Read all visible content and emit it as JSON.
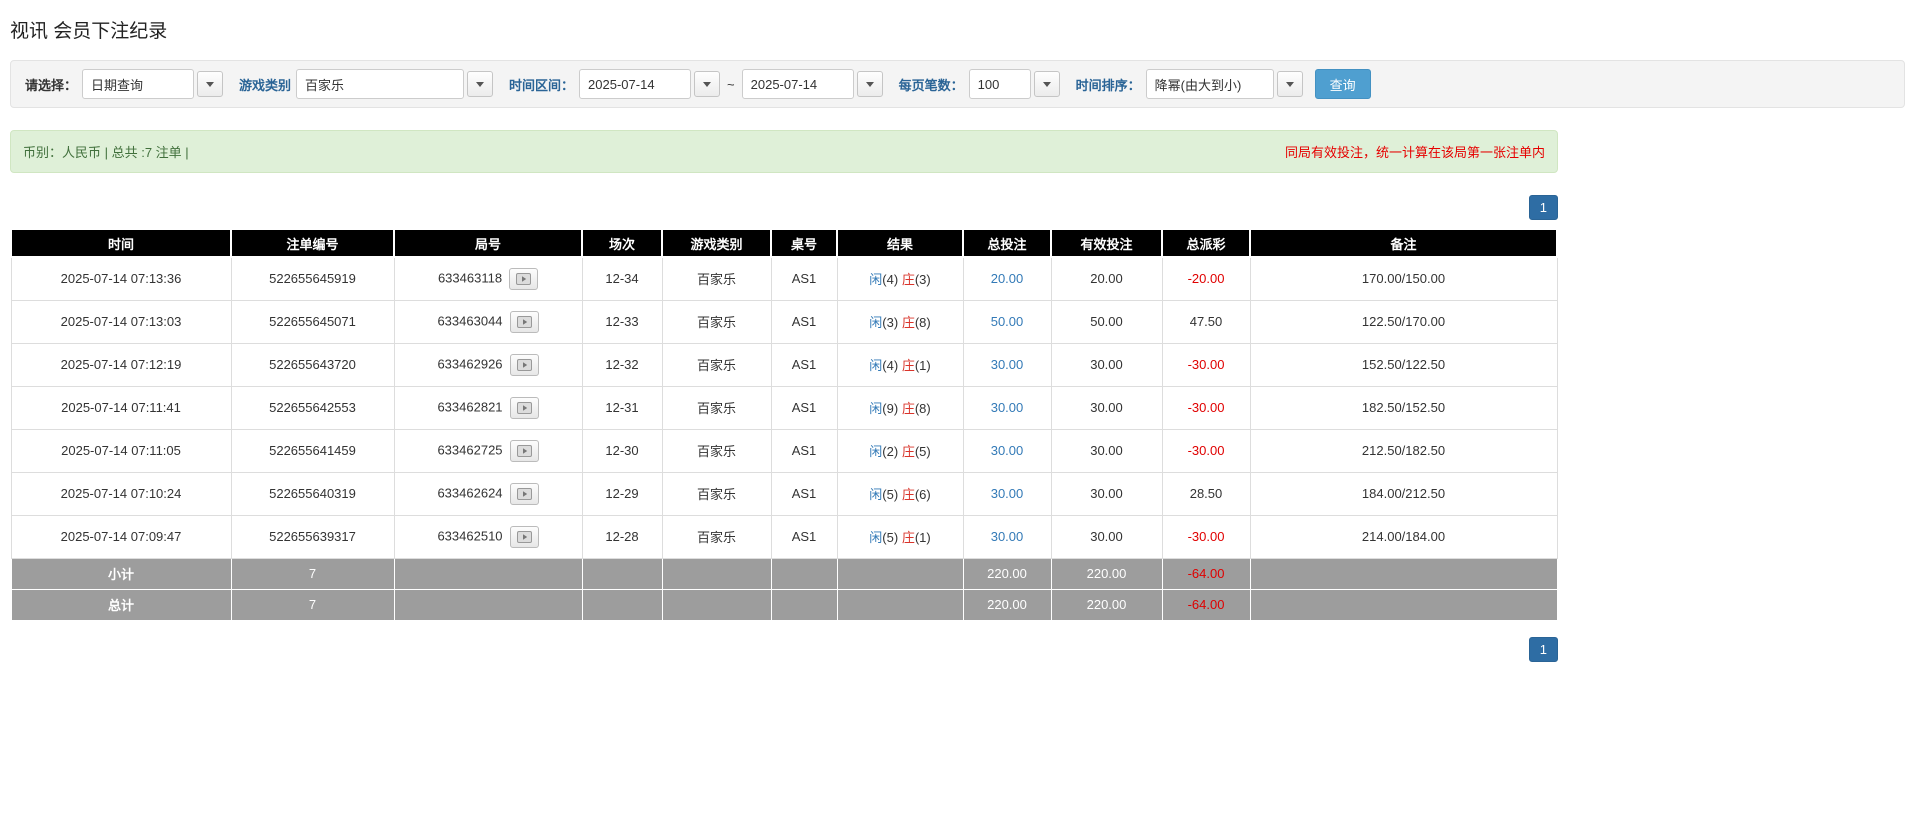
{
  "page": {
    "title": "视讯 会员下注纪录"
  },
  "filters": {
    "select_label": "请选择：",
    "select_value": "日期查询",
    "game_type_label": "游戏类别",
    "game_type_value": "百家乐",
    "date_range_label": "时间区间：",
    "date_from": "2025-07-14",
    "date_separator": "~",
    "date_to": "2025-07-14",
    "page_size_label": "每页笔数：",
    "page_size_value": "100",
    "sort_label": "时间排序：",
    "sort_value": "降幂(由大到小)",
    "search_button": "查询"
  },
  "summary": {
    "left": "币别：人民币 | 总共 :7 注单 |",
    "right": "同局有效投注，统一计算在该局第一张注单内"
  },
  "pagination": {
    "page": "1"
  },
  "table": {
    "headers": [
      "时间",
      "注单编号",
      "局号",
      "场次",
      "游戏类别",
      "桌号",
      "结果",
      "总投注",
      "有效投注",
      "总派彩",
      "备注"
    ],
    "rows": [
      {
        "time": "2025-07-14 07:13:36",
        "bet_id": "522655645919",
        "round_id": "633463118",
        "session": "12-34",
        "game": "百家乐",
        "table_no": "AS1",
        "result_player": "闲",
        "result_player_num": "(4)",
        "result_banker": "庄",
        "result_banker_num": "(3)",
        "total_bet": "20.00",
        "valid_bet": "20.00",
        "payout": "-20.00",
        "remark": "170.00/150.00"
      },
      {
        "time": "2025-07-14 07:13:03",
        "bet_id": "522655645071",
        "round_id": "633463044",
        "session": "12-33",
        "game": "百家乐",
        "table_no": "AS1",
        "result_player": "闲",
        "result_player_num": "(3)",
        "result_banker": "庄",
        "result_banker_num": "(8)",
        "total_bet": "50.00",
        "valid_bet": "50.00",
        "payout": "47.50",
        "remark": "122.50/170.00"
      },
      {
        "time": "2025-07-14 07:12:19",
        "bet_id": "522655643720",
        "round_id": "633462926",
        "session": "12-32",
        "game": "百家乐",
        "table_no": "AS1",
        "result_player": "闲",
        "result_player_num": "(4)",
        "result_banker": "庄",
        "result_banker_num": "(1)",
        "total_bet": "30.00",
        "valid_bet": "30.00",
        "payout": "-30.00",
        "remark": "152.50/122.50"
      },
      {
        "time": "2025-07-14 07:11:41",
        "bet_id": "522655642553",
        "round_id": "633462821",
        "session": "12-31",
        "game": "百家乐",
        "table_no": "AS1",
        "result_player": "闲",
        "result_player_num": "(9)",
        "result_banker": "庄",
        "result_banker_num": "(8)",
        "total_bet": "30.00",
        "valid_bet": "30.00",
        "payout": "-30.00",
        "remark": "182.50/152.50"
      },
      {
        "time": "2025-07-14 07:11:05",
        "bet_id": "522655641459",
        "round_id": "633462725",
        "session": "12-30",
        "game": "百家乐",
        "table_no": "AS1",
        "result_player": "闲",
        "result_player_num": "(2)",
        "result_banker": "庄",
        "result_banker_num": "(5)",
        "total_bet": "30.00",
        "valid_bet": "30.00",
        "payout": "-30.00",
        "remark": "212.50/182.50"
      },
      {
        "time": "2025-07-14 07:10:24",
        "bet_id": "522655640319",
        "round_id": "633462624",
        "session": "12-29",
        "game": "百家乐",
        "table_no": "AS1",
        "result_player": "闲",
        "result_player_num": "(5)",
        "result_banker": "庄",
        "result_banker_num": "(6)",
        "total_bet": "30.00",
        "valid_bet": "30.00",
        "payout": "28.50",
        "remark": "184.00/212.50"
      },
      {
        "time": "2025-07-14 07:09:47",
        "bet_id": "522655639317",
        "round_id": "633462510",
        "session": "12-28",
        "game": "百家乐",
        "table_no": "AS1",
        "result_player": "闲",
        "result_player_num": "(5)",
        "result_banker": "庄",
        "result_banker_num": "(1)",
        "total_bet": "30.00",
        "valid_bet": "30.00",
        "payout": "-30.00",
        "remark": "214.00/184.00"
      }
    ],
    "subtotal": {
      "label": "小计",
      "count": "7",
      "total_bet": "220.00",
      "valid_bet": "220.00",
      "payout": "-64.00"
    },
    "total": {
      "label": "总计",
      "count": "7",
      "total_bet": "220.00",
      "valid_bet": "220.00",
      "payout": "-64.00"
    }
  }
}
